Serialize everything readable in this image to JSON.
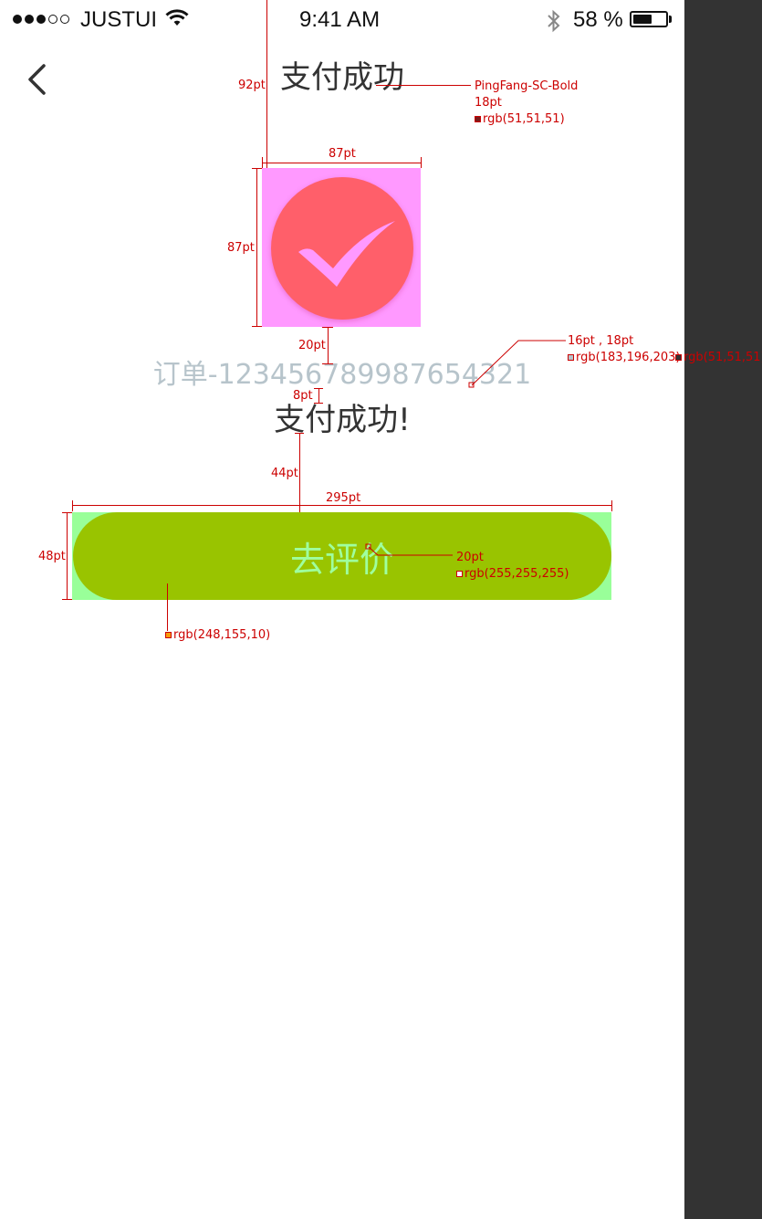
{
  "status_bar": {
    "carrier": "JUSTUI",
    "time": "9:41 AM",
    "battery_percent": "58 %",
    "battery_level": 0.58,
    "signal_bars_filled": 3,
    "signal_bars_total": 5
  },
  "nav": {
    "back_icon": "chevron-left-icon",
    "title": "支付成功"
  },
  "result": {
    "icon": "check-circle-icon",
    "order_number": "订单-123456789987654321",
    "message": "支付成功!"
  },
  "action": {
    "review_button_label": "去评价"
  },
  "annotations": {
    "title_spacing": "92pt",
    "title_font": "PingFang-SC-Bold",
    "title_size": "18pt",
    "title_color": "rgb(51,51,51)",
    "icon_width": "87pt",
    "icon_height": "87pt",
    "icon_gap": "20pt",
    "order_sizes": "16pt , 18pt",
    "order_color": "rgb(183,196,203)",
    "message_color": "rgb(51,51,51)",
    "text_gap": "8pt",
    "button_gap": "44pt",
    "button_width": "295pt",
    "button_height": "48pt",
    "button_font_size": "20pt",
    "button_text_color": "rgb(255,255,255)",
    "button_bg_color": "rgb(248,155,10)"
  },
  "colors": {
    "swatch_title": "#333333",
    "swatch_order": "#b7c4cb",
    "swatch_button_text": "#ffffff",
    "swatch_button_bg": "#f89b0a"
  }
}
